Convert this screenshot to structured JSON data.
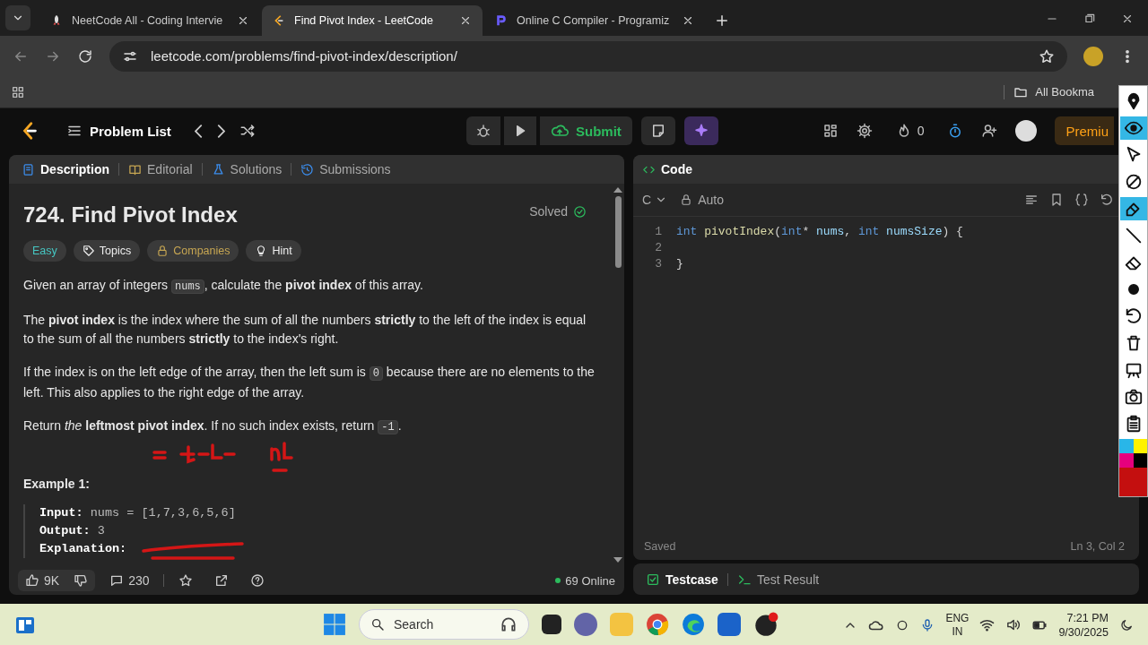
{
  "browser": {
    "tabs": [
      {
        "title": "NeetCode All - Coding Intervie",
        "selected": false,
        "kind": "rocket"
      },
      {
        "title": "Find Pivot Index - LeetCode",
        "selected": true,
        "kind": "leetcode"
      },
      {
        "title": "Online C Compiler - Programiz",
        "selected": false,
        "kind": "programiz"
      }
    ],
    "url": "leetcode.com/problems/find-pivot-index/description/",
    "bookmarks": [
      "All Bookma"
    ]
  },
  "nav": {
    "problem_list": "Problem List",
    "submit": "Submit",
    "streak": "0",
    "premium": "Premiu"
  },
  "left_tabs": [
    {
      "label": "Description",
      "selected": true,
      "kind": "description"
    },
    {
      "label": "Editorial",
      "selected": false,
      "kind": "editorial"
    },
    {
      "label": "Solutions",
      "selected": false,
      "kind": "solutions"
    },
    {
      "label": "Submissions",
      "selected": false,
      "kind": "submissions"
    }
  ],
  "problem": {
    "title": "724. Find Pivot Index",
    "status": "Solved",
    "tags": [
      {
        "label": "Easy",
        "kind": "difficulty"
      },
      {
        "label": "Topics",
        "kind": "topics"
      },
      {
        "label": "Companies",
        "kind": "locked"
      },
      {
        "label": "Hint",
        "kind": "hint"
      }
    ],
    "paragraphs": [
      [
        {
          "kind": "text",
          "text": "Given an array of integers "
        },
        {
          "kind": "code",
          "text": "nums"
        },
        {
          "kind": "text",
          "text": ", calculate the **pivot index** of this array."
        }
      ],
      [
        {
          "kind": "text",
          "text": "The **pivot index** is the index where the sum of all the numbers **strictly** to the left of the index is equal to the sum of all the numbers **strictly** to the index's right."
        }
      ],
      [
        {
          "kind": "text",
          "text": "If the index is on the left edge of the array, then the left sum is "
        },
        {
          "kind": "code",
          "text": "0"
        },
        {
          "kind": "text",
          "text": " because there are no elements to the left. This also applies to the right edge of the array."
        }
      ],
      [
        {
          "kind": "text",
          "text": "Return *the* **leftmost pivot index**. If no such index exists, return "
        },
        {
          "kind": "code",
          "text": "-1"
        },
        {
          "kind": "text",
          "text": "."
        }
      ]
    ],
    "example": {
      "heading": "Example 1:",
      "lines": [
        {
          "label": "Input:",
          "value": "nums = [1,7,3,6,5,6]"
        },
        {
          "label": "Output:",
          "value": "3"
        },
        {
          "label": "Explanation:"
        }
      ]
    },
    "likes": "9K",
    "comments": "230",
    "online": "69 Online"
  },
  "editor": {
    "title": "Code",
    "language": "C",
    "mode": "Auto",
    "lines": [
      {
        "number": "1",
        "tokens": [
          {
            "kind": "keyword",
            "text": "int"
          },
          {
            "kind": "function",
            "text": " pivotIndex"
          },
          {
            "kind": "plain",
            "text": "("
          },
          {
            "kind": "keyword",
            "text": "int"
          },
          {
            "kind": "plain",
            "text": "* "
          },
          {
            "kind": "variable",
            "text": "nums"
          },
          {
            "kind": "plain",
            "text": ", "
          },
          {
            "kind": "keyword",
            "text": "int"
          },
          {
            "kind": "variable",
            "text": " numsSize"
          },
          {
            "kind": "plain",
            "text": ") {"
          }
        ]
      },
      {
        "number": "2"
      },
      {
        "number": "3",
        "tokens": [
          {
            "kind": "plain",
            "text": "}"
          }
        ]
      }
    ],
    "status": "Saved",
    "cursor": "Ln 3, Col 2"
  },
  "bottom_tabs": [
    {
      "label": "Testcase",
      "selected": true,
      "kind": "testcase"
    },
    {
      "label": "Test Result",
      "selected": false,
      "kind": "result"
    }
  ],
  "annotation_palette": [
    {
      "color": "#29b6e8"
    },
    {
      "color": "#fff200"
    },
    {
      "color": "#e6007e"
    },
    {
      "color": "#000000"
    },
    {
      "color": "#c40f0f"
    }
  ],
  "taskbar": {
    "search": "Search",
    "language": "ENG",
    "region": "IN",
    "time": "7:21 PM",
    "date": "9/30/2025"
  }
}
